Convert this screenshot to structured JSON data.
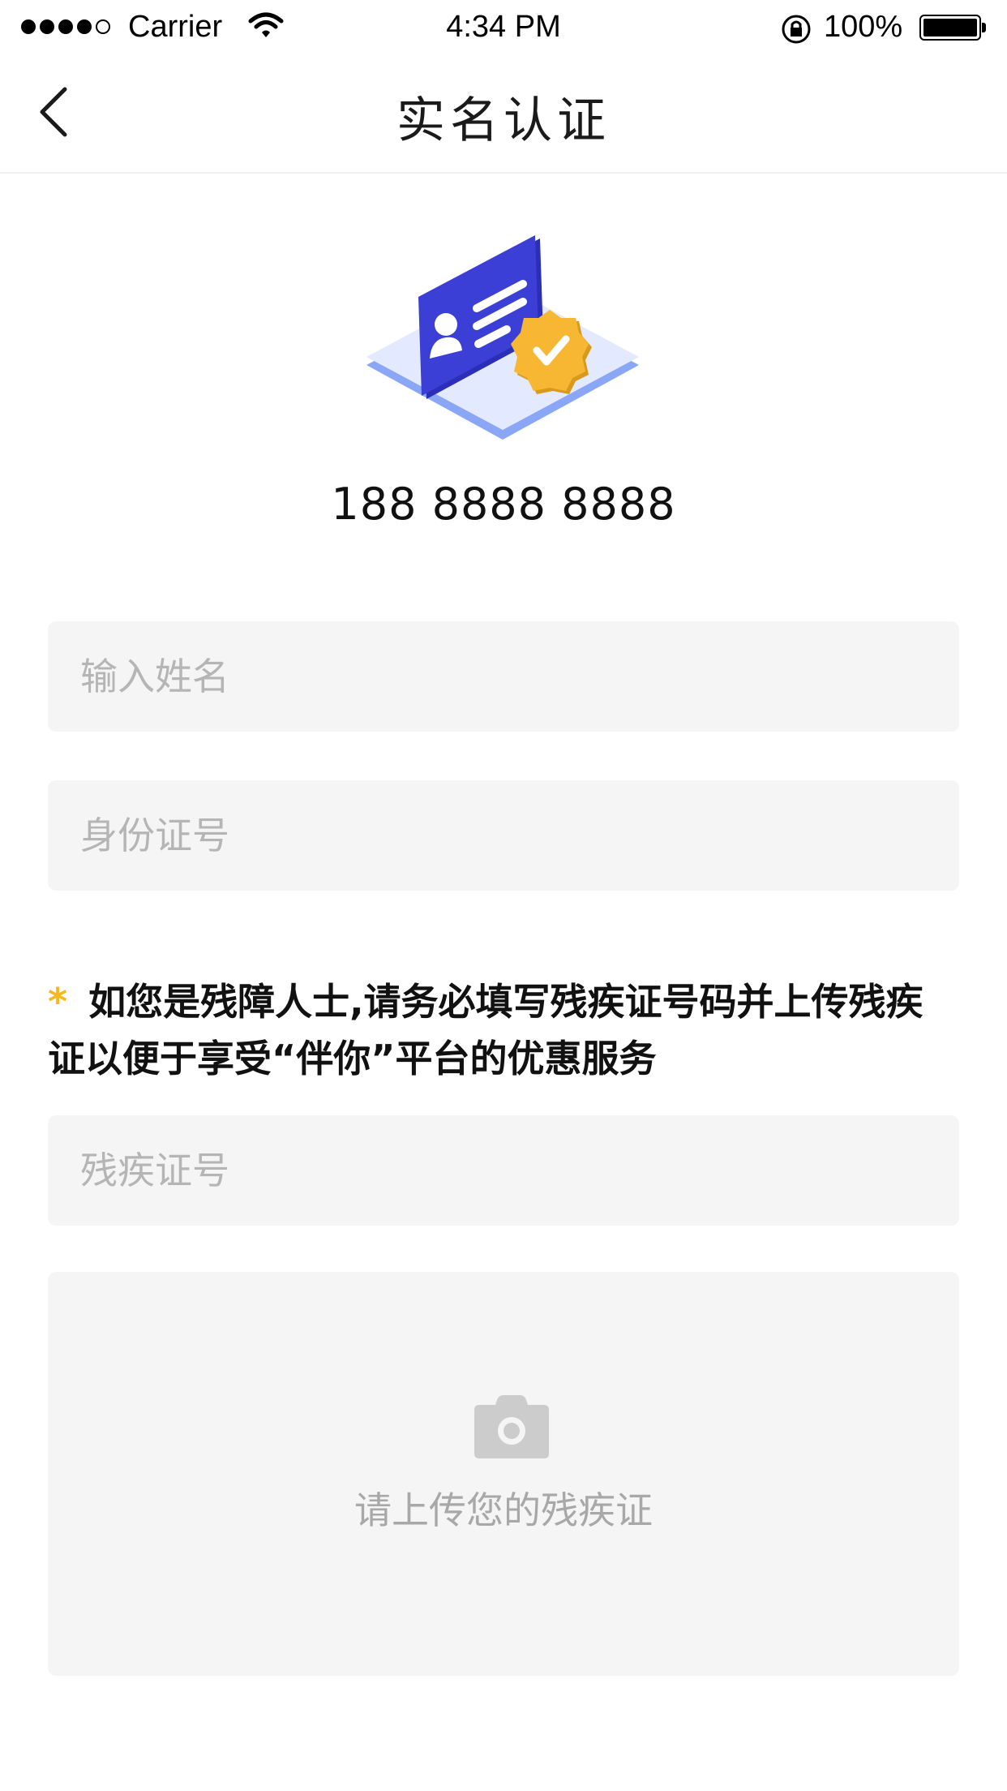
{
  "status_bar": {
    "carrier": "Carrier",
    "time": "4:34 PM",
    "battery": "100%"
  },
  "nav": {
    "title": "实名认证",
    "back_icon": "chevron-left-icon"
  },
  "illustration": {
    "icon": "id-card-verified-icon",
    "colors": {
      "card": "#3b3fd6",
      "badge": "#f7b733",
      "platform": "#e3eaff",
      "platform_edge": "#8aa6f7"
    }
  },
  "phone_number": "188 8888 8888",
  "form": {
    "name_placeholder": "输入姓名",
    "id_placeholder": "身份证号",
    "notice_star": "*",
    "notice_text": "如您是残障人士,请务必填写残疾证号码并上传残疾 证以便于享受“伴你”平台的优惠服务",
    "disability_placeholder": "残疾证号",
    "upload_label": "请上传您的残疾证",
    "upload_icon": "camera-icon"
  },
  "colors": {
    "accent_star": "#f5b81f",
    "field_bg": "#f5f5f5",
    "placeholder": "#b5b5b5"
  }
}
